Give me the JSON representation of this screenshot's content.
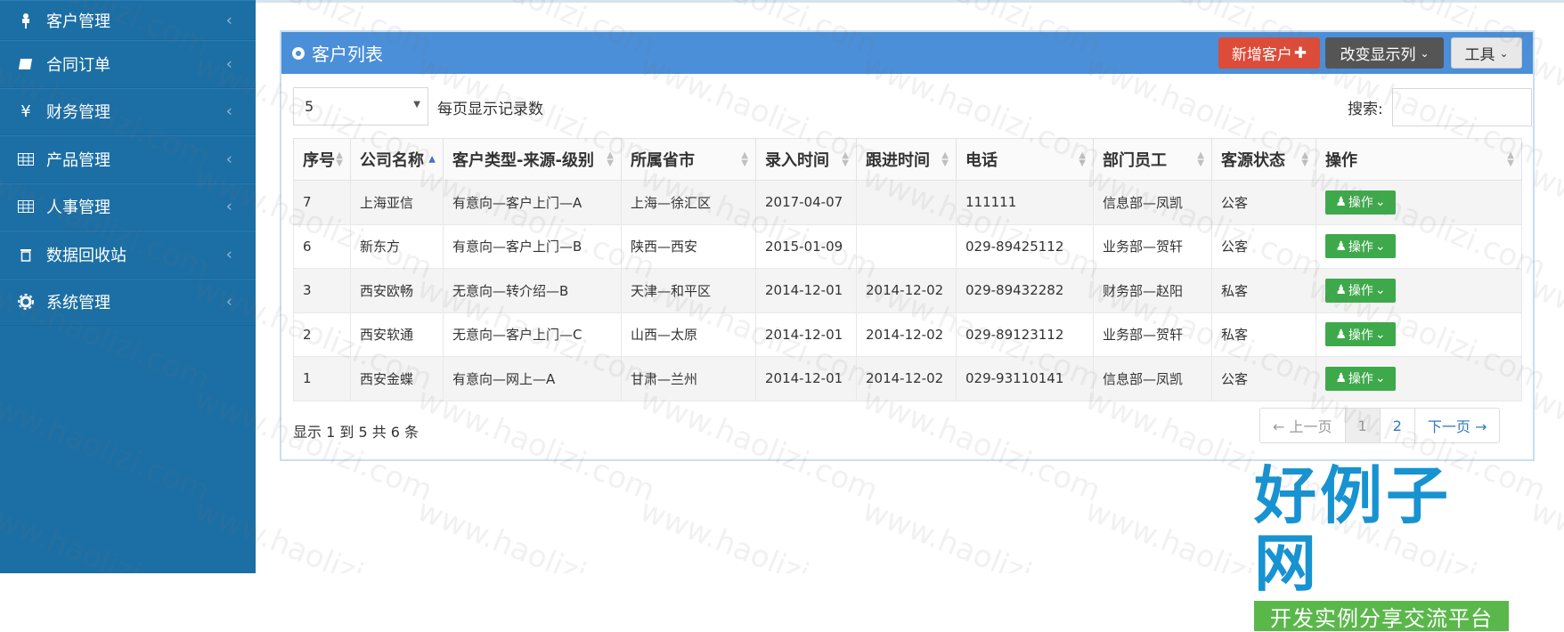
{
  "sidebar": {
    "items": [
      {
        "label": "客户管理",
        "icon": "pin-icon"
      },
      {
        "label": "合同订单",
        "icon": "book-icon"
      },
      {
        "label": "财务管理",
        "icon": "yen-icon"
      },
      {
        "label": "产品管理",
        "icon": "grid-icon"
      },
      {
        "label": "人事管理",
        "icon": "grid-icon"
      },
      {
        "label": "数据回收站",
        "icon": "trash-icon"
      },
      {
        "label": "系统管理",
        "icon": "gear-icon"
      }
    ]
  },
  "panel": {
    "title": "客户列表",
    "add_button": "新增客户",
    "columns_button": "改变显示列",
    "tools_button": "工具"
  },
  "controls": {
    "page_size": "5",
    "page_size_label": "每页显示记录数",
    "search_label": "搜索:",
    "search_value": ""
  },
  "table": {
    "headers": [
      "序号",
      "公司名称",
      "客户类型-来源-级别",
      "所属省市",
      "录入时间",
      "跟进时间",
      "电话",
      "部门员工",
      "客源状态",
      "操作"
    ],
    "rows": [
      [
        "7",
        "上海亚信",
        "有意向—客户上门—A",
        "上海—徐汇区",
        "2017-04-07",
        "",
        "111111",
        "信息部—凤凯",
        "公客",
        "操作"
      ],
      [
        "6",
        "新东方",
        "有意向—客户上门—B",
        "陕西—西安",
        "2015-01-09",
        "",
        "029-89425112",
        "业务部—贺轩",
        "公客",
        "操作"
      ],
      [
        "3",
        "西安欧畅",
        "无意向—转介绍—B",
        "天津—和平区",
        "2014-12-01",
        "2014-12-02",
        "029-89432282",
        "财务部—赵阳",
        "私客",
        "操作"
      ],
      [
        "2",
        "西安软通",
        "无意向—客户上门—C",
        "山西—太原",
        "2014-12-01",
        "2014-12-02",
        "029-89123112",
        "业务部—贺轩",
        "私客",
        "操作"
      ],
      [
        "1",
        "西安金蝶",
        "有意向—网上—A",
        "甘肃—兰州",
        "2014-12-01",
        "2014-12-02",
        "029-93110141",
        "信息部—凤凯",
        "公客",
        "操作"
      ]
    ]
  },
  "footer": {
    "summary": "显示 1 到 5 共 6 条",
    "pager": [
      "← 上一页",
      "1",
      "2",
      "下一页 →"
    ]
  },
  "logo": {
    "title": "好例子网",
    "subtitle": "开发实例分享交流平台"
  },
  "watermark_text": "www.haolizi.com",
  "colors": {
    "sidebar": "#1c6fa5",
    "panel_header": "#4a8fd8",
    "add_button": "#dd4b39",
    "op_button": "#3ea94a"
  }
}
